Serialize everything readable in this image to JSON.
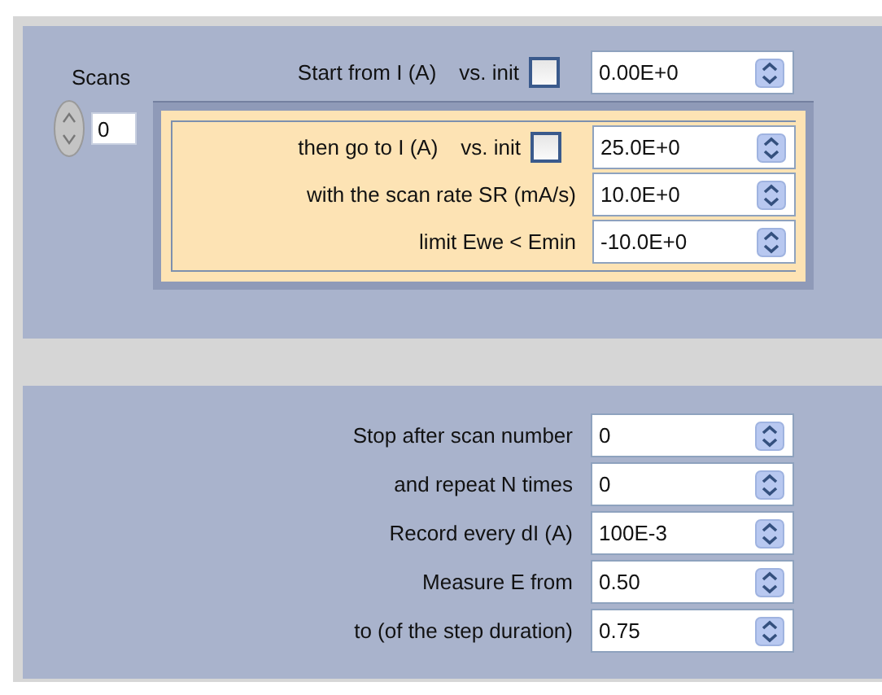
{
  "scans": {
    "label": "Scans",
    "value": "0"
  },
  "start": {
    "label": "Start from I (A)",
    "vs_label": "vs. init",
    "vs_init": false,
    "value": "0.00E+0"
  },
  "scan_rows": [
    {
      "kind": "check",
      "label": "then go to I (A)",
      "vs_label": "vs. init",
      "vs_init": false,
      "value": "25.0E+0"
    },
    {
      "kind": "plain",
      "label": "with the scan rate SR (mA/s)",
      "value": "10.0E+0"
    },
    {
      "kind": "plain",
      "label": "limit Ewe < Emin",
      "value": "-10.0E+0"
    }
  ],
  "settings": [
    {
      "label": "Stop after scan number",
      "value": "0"
    },
    {
      "label": "and repeat N times",
      "value": "0"
    },
    {
      "label": "Record every dI (A)",
      "value": "100E-3"
    },
    {
      "label": "Measure E from",
      "value": "0.50"
    },
    {
      "label": "to (of the step duration)",
      "value": "0.75"
    }
  ]
}
